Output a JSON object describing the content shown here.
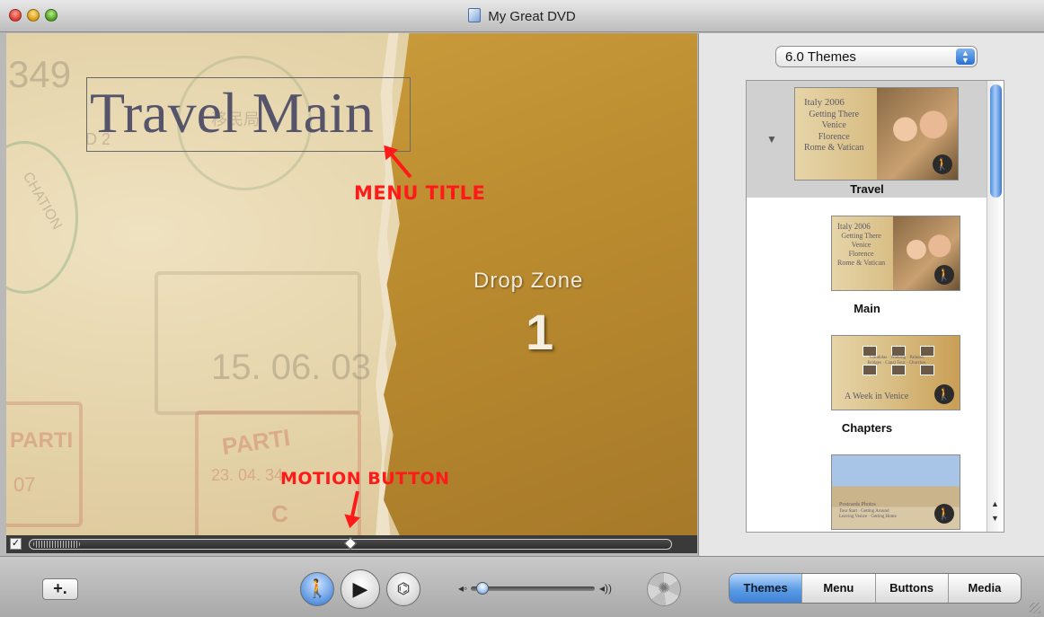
{
  "window": {
    "title": "My Great DVD"
  },
  "canvas": {
    "menu_title": "Travel Main",
    "drop_zone_label": "Drop Zone",
    "drop_zone_number": "1",
    "annotations": {
      "menu_title": "MENU TITLE",
      "motion_button": "MOTION BUTTON"
    },
    "background_stamps": [
      "349",
      "D 2",
      "15. 06. 03",
      "PARTI",
      "PARTI",
      "23. 04. 34",
      "07",
      "C",
      "CHATION",
      "移民局"
    ],
    "scrub_enabled": true
  },
  "panel": {
    "theme_select": "6.0 Themes",
    "themes": [
      {
        "label": "Travel",
        "selected": true,
        "thumb_lines": [
          "Italy 2006",
          "Getting There",
          "Venice",
          "Florence",
          "Rome & Vatican"
        ]
      },
      {
        "label": "Main",
        "selected": false,
        "thumb_lines": [
          "Italy 2006",
          "Getting There",
          "Venice",
          "Florence",
          "Rome & Vatican"
        ]
      },
      {
        "label": "Chapters",
        "selected": false,
        "thumb_lines": [
          "Gondolas",
          "Walking",
          "Palazzo",
          "Bridges",
          "Canal Tour",
          "Churches",
          "A Week in Venice"
        ]
      },
      {
        "label": "",
        "selected": false,
        "thumb_lines": [
          "Postcards Photos",
          "Tour Start",
          "Getting Around",
          "Leaving Venice",
          "Getting Home"
        ]
      }
    ]
  },
  "toolbar": {
    "add_label": "+.",
    "tabs": [
      "Themes",
      "Menu",
      "Buttons",
      "Media"
    ],
    "active_tab": "Themes",
    "volume_level": 0.05
  },
  "colors": {
    "annotation": "#ff1a1a",
    "active_tab": "#5b9be4",
    "menu_title_text": "#55546a"
  },
  "icons": {
    "close": "red-traffic-light-icon",
    "minimize": "yellow-traffic-light-icon",
    "zoom": "green-traffic-light-icon",
    "motion": "walking-man-icon",
    "play": "play-icon",
    "map": "dvd-map-icon",
    "volume_low": "speaker-low-icon",
    "volume_high": "speaker-high-icon",
    "burn": "aperture-icon"
  }
}
